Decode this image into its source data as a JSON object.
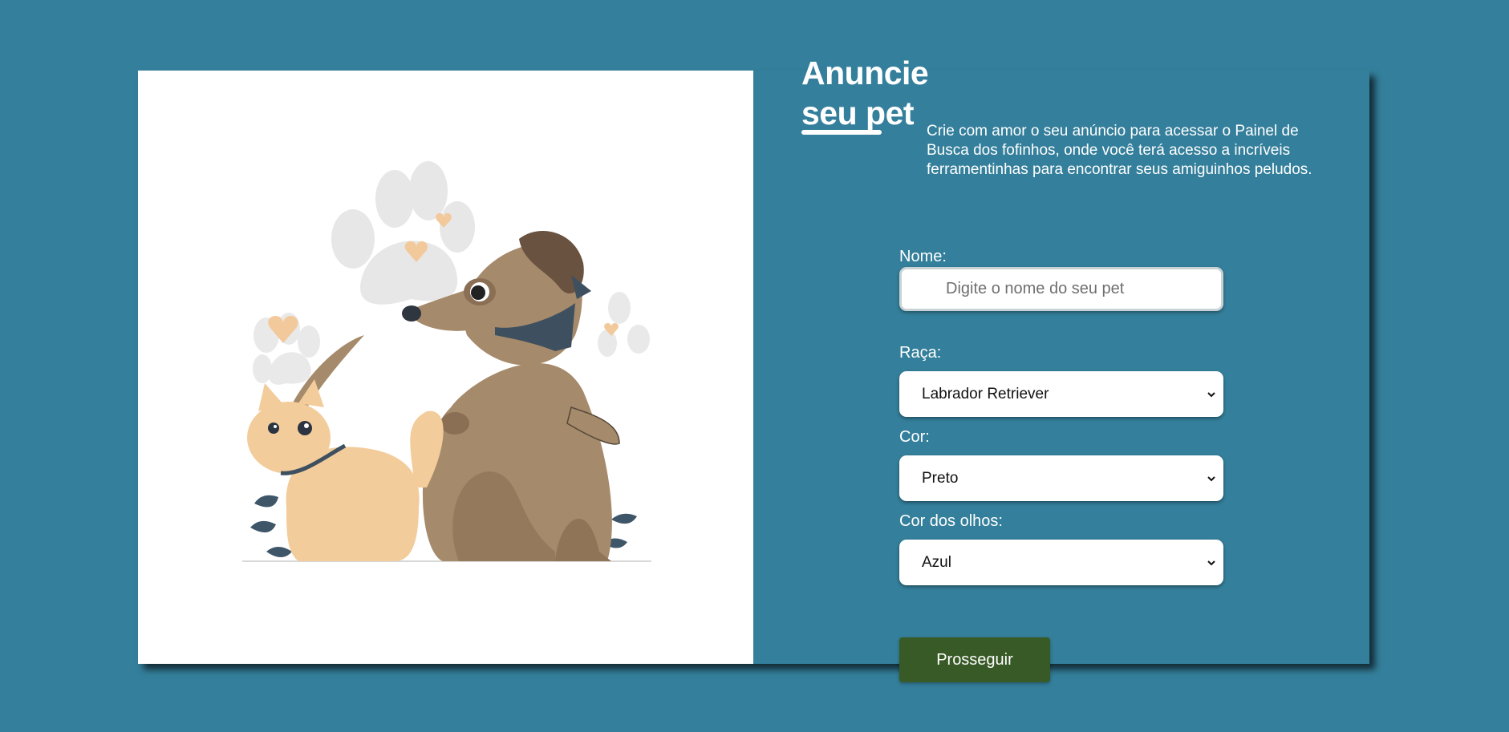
{
  "title": {
    "line1": "Anuncie",
    "line2": "seu pet"
  },
  "description": "Crie com amor o seu anúncio para acessar o Painel de Busca dos fofinhos, onde você terá acesso a incríveis ferramentinhas para encontrar seus amiguinhos peludos.",
  "form": {
    "name": {
      "label": "Nome:",
      "placeholder": "Digite o nome do seu pet",
      "value": ""
    },
    "breed": {
      "label": "Raça:",
      "selected": "Labrador Retriever"
    },
    "color": {
      "label": "Cor:",
      "selected": "Preto"
    },
    "eye_color": {
      "label": "Cor dos olhos:",
      "selected": "Azul"
    },
    "submit_label": "Prosseguir"
  },
  "colors": {
    "page_background": "#347f9b",
    "illustration_background": "#ffffff",
    "button_background": "#385a26",
    "text_light": "#ffffff"
  },
  "icons": {
    "select_arrow": "chevron-down-icon"
  },
  "illustration": {
    "subject": "cat-and-dog-illustration"
  }
}
